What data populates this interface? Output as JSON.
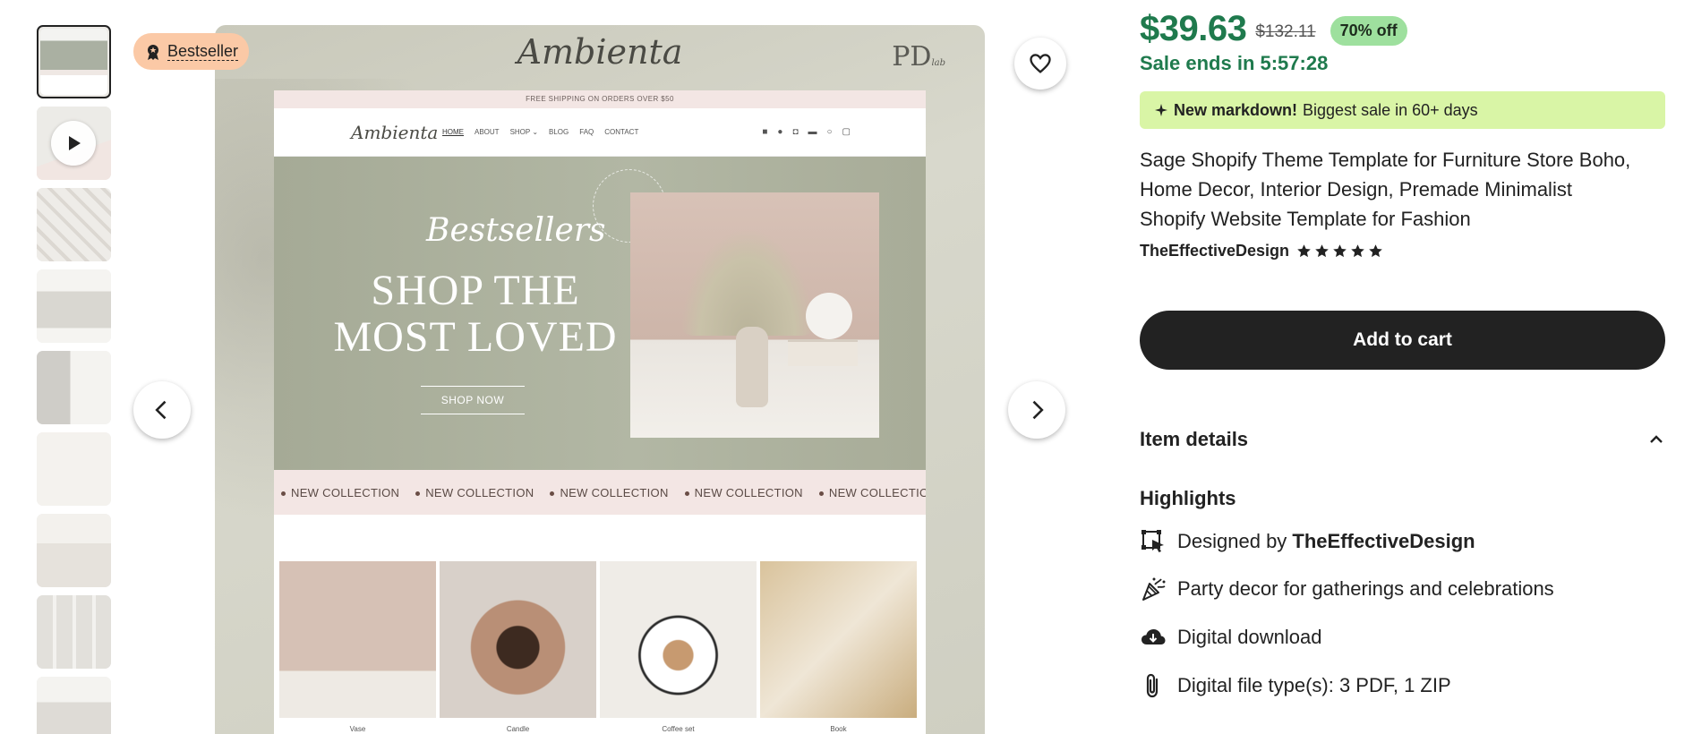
{
  "badge": {
    "label": "Bestseller"
  },
  "mockup": {
    "brand": "Ambienta",
    "pd_logo": "PD",
    "pd_logo_sub": "lab",
    "shipping_banner": "FREE SHIPPING ON ORDERS OVER $50",
    "nav_logo": "Ambienta",
    "nav_links": [
      "HOME",
      "ABOUT",
      "SHOP ⌄",
      "BLOG",
      "FAQ",
      "CONTACT"
    ],
    "hero_script": "Bestsellers",
    "hero_line1": "SHOP THE",
    "hero_line2": "MOST LOVED",
    "hero_button": "SHOP NOW",
    "marquee": [
      "NEW COLLECTION",
      "NEW COLLECTION",
      "NEW COLLECTION",
      "NEW COLLECTION",
      "NEW COLLECTION"
    ],
    "products": [
      "Vase",
      "Candle",
      "Coffee set",
      "Book"
    ]
  },
  "price": {
    "current": "$39.63",
    "original": "$132.11",
    "discount": "70% off",
    "sale_ends": "Sale ends in 5:57:28",
    "color": "#1f7a4d"
  },
  "markdown": {
    "bold": "New markdown!",
    "text": "Biggest sale in 60+ days"
  },
  "listing": {
    "title": "Sage Shopify Theme Template for Furniture Store Boho, Home Decor, Interior Design, Premade Minimalist Shopify Website Template for Fashion",
    "shop": "TheEffectiveDesign",
    "rating_stars": 5
  },
  "actions": {
    "add_to_cart": "Add to cart"
  },
  "details": {
    "label": "Item details",
    "highlights_label": "Highlights",
    "highlights": [
      {
        "icon": "designer-icon",
        "prefix": "Designed by ",
        "bold": "TheEffectiveDesign"
      },
      {
        "icon": "party-popper-icon",
        "text": "Party decor for gatherings and celebrations"
      },
      {
        "icon": "cloud-download-icon",
        "text": "Digital download"
      },
      {
        "icon": "paperclip-icon",
        "text": "Digital file type(s): 3 PDF, 1 ZIP"
      }
    ]
  }
}
